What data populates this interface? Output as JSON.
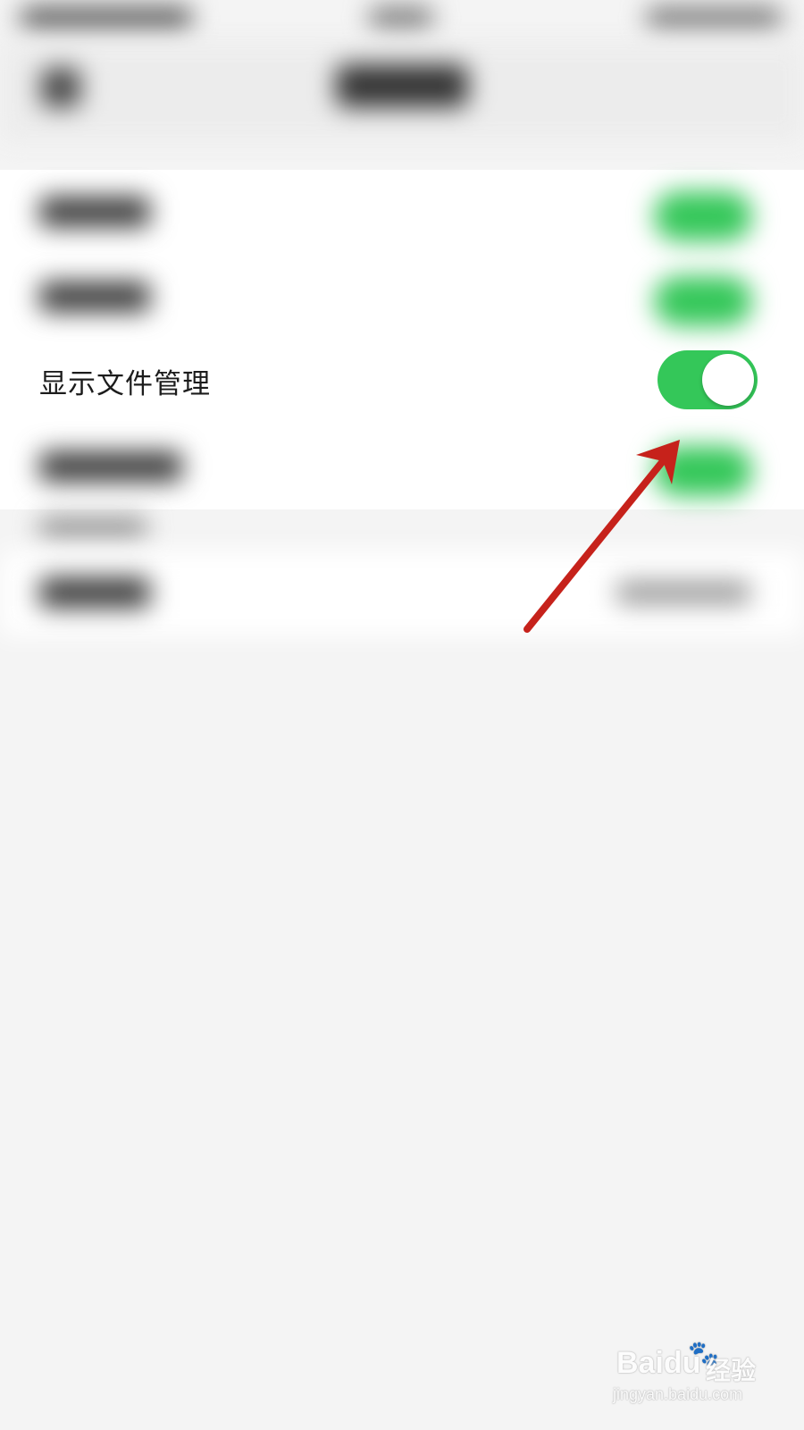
{
  "settings": {
    "rows": [
      {
        "label": "显示文件管理",
        "enabled": true
      }
    ]
  },
  "colors": {
    "toggle_on": "#34c759",
    "arrow": "#c6221b",
    "background": "#f4f4f4"
  },
  "watermark": {
    "brand": "Baidu",
    "brand_cn": "经验",
    "domain": "jingyan.baidu.com"
  },
  "icons": {
    "watermark_logo": "paw-icon"
  }
}
